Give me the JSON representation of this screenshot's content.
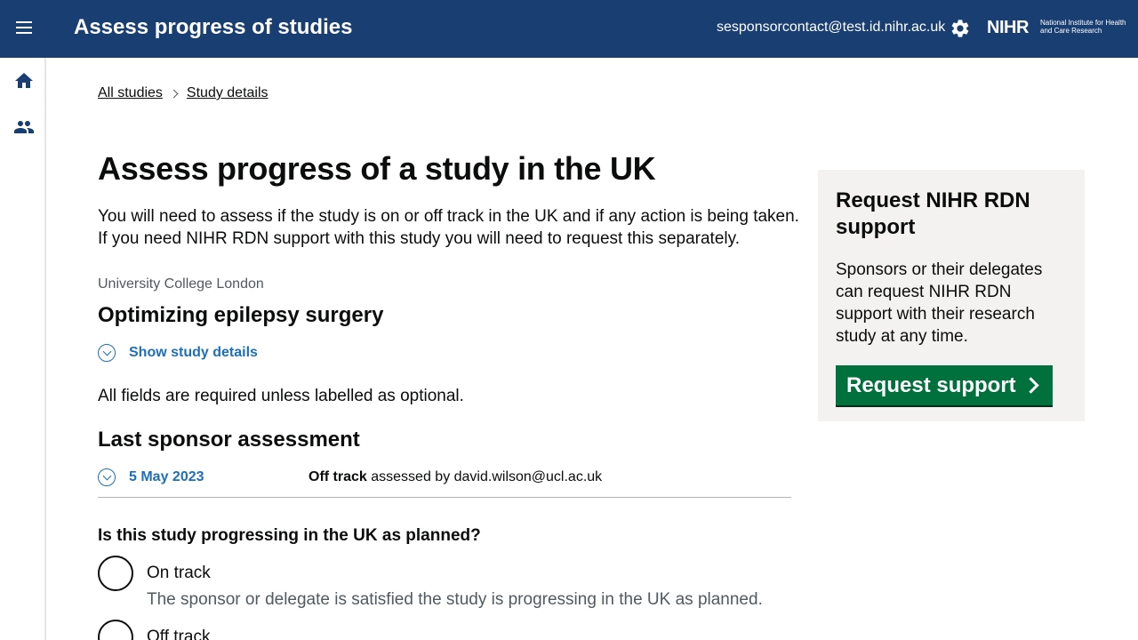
{
  "header": {
    "app_title": "Assess progress of studies",
    "user_email": "sesponsorcontact@test.id.nihr.ac.uk",
    "logo_text": "NIHR",
    "logo_subtext": "National Institute for Health and Care Research",
    "background_color": "#193e72"
  },
  "sidenav": {
    "items": [
      {
        "icon": "home-icon"
      },
      {
        "icon": "users-icon"
      }
    ]
  },
  "breadcrumb": {
    "items": [
      "All studies",
      "Study details"
    ]
  },
  "main": {
    "title": "Assess progress of a study in the UK",
    "intro": "You will need to assess if the study is on or off track in the UK and if any action is being taken. If you need NIHR RDN support with this study you will need to request this separately.",
    "organisation": "University College London",
    "study_title": "Optimizing epilepsy surgery",
    "show_details_label": "Show study details",
    "required_note": "All fields are required unless labelled as optional.",
    "last_assessment_heading": "Last sponsor assessment",
    "last_assessment": {
      "date": "5 May 2023",
      "status": "Off track",
      "assessed_by_text": "assessed by david.wilson@ucl.ac.uk"
    },
    "question": "Is this study progressing in the UK as planned?",
    "options": [
      {
        "label": "On track",
        "hint": "The sponsor or delegate is satisfied the study is progressing in the UK as planned."
      },
      {
        "label": "Off track"
      }
    ]
  },
  "aside": {
    "title": "Request NIHR RDN support",
    "text": "Sponsors or their delegates can request NIHR RDN support with their research study at any time.",
    "button_label": "Request support",
    "button_color": "#00703c",
    "background_color": "#f3f2f1"
  },
  "colors": {
    "link": "#1d70b8",
    "text": "#0b0c0c",
    "secondary_text": "#505a5f"
  }
}
